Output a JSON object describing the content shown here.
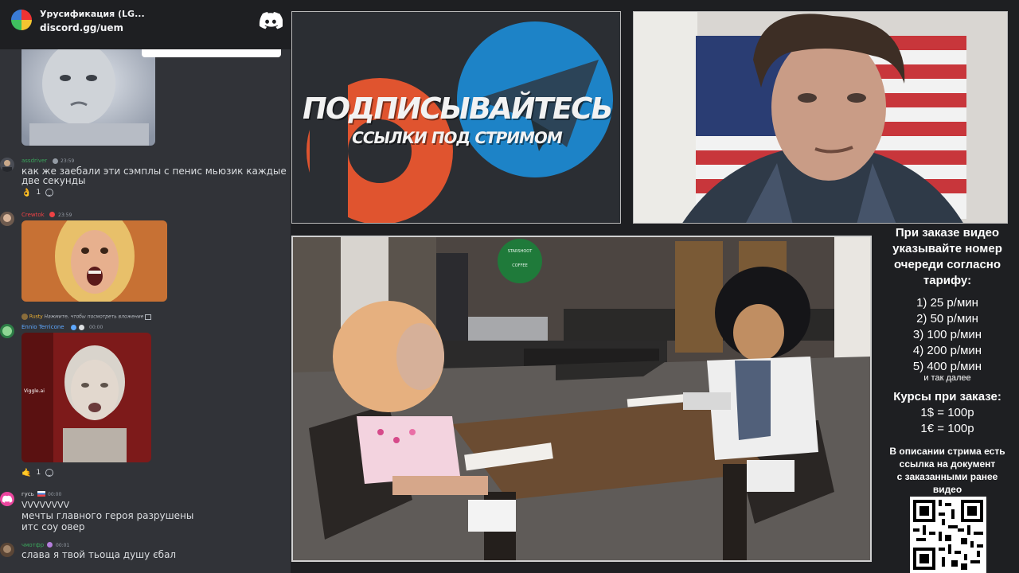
{
  "server": {
    "name": "Урусификация (LG...",
    "invite": "discord.gg/uem"
  },
  "messages": [
    {
      "user": "assdriver",
      "time": "23:59",
      "lines": [
        "как же заебали эти сэмплы с пенис мьюзик каждые",
        "две секунды"
      ],
      "reaction_count": "1",
      "reaction_emoji": "👌"
    },
    {
      "user": "Crewtok",
      "time": "23:59",
      "attachment": "face-scream-image"
    },
    {
      "reply_user": "Rusty",
      "reply_text": "Нажмите, чтобы посмотреть вложение",
      "user": "Ennio Terricone",
      "time": "00:00",
      "attachment_watermark": "Viggle.ai",
      "reaction_count": "1",
      "reaction_emoji": "🤙"
    },
    {
      "user": "гусь",
      "time": "00:00",
      "lines": [
        "VVVVVVVV",
        "мечты главного героя разрушены",
        "итс соу овер"
      ]
    },
    {
      "user": "чмотфр",
      "time": "00:01",
      "lines": [
        "слава я твой тьоща душу єбал"
      ]
    }
  ],
  "promo": {
    "title": "ПОДПИСЫВАЙТЕСЬ",
    "subtitle": "ССЫЛКИ ПОД СТРИМОМ"
  },
  "game": {
    "cafe_sign_line1": "STARSHOOT",
    "cafe_sign_line2": "COFFEE"
  },
  "info": {
    "header_lines": [
      "При заказе видео",
      "указывайте номер",
      "очереди согласно",
      "тарифу:"
    ],
    "tariffs": [
      "1) 25 р/мин",
      "2) 50 р/мин",
      "3) 100 р/мин",
      "4) 200 р/мин",
      "5) 400 р/мин"
    ],
    "tariffs_more": "и так далее",
    "rates_header": "Курсы при заказе:",
    "rates": [
      "1$ = 100р",
      "1€ = 100р"
    ],
    "description_lines": [
      "В описании стрима есть",
      "ссылка на документ",
      "с заказанными ранее",
      "видео"
    ]
  },
  "colors": {
    "chat_bg": "#313338",
    "username_green": "#3ba55c",
    "username_red": "#ed4245",
    "username_blue": "#5ea8ff",
    "username_pink": "#f47fff",
    "username_yellow": "#f0b232"
  }
}
